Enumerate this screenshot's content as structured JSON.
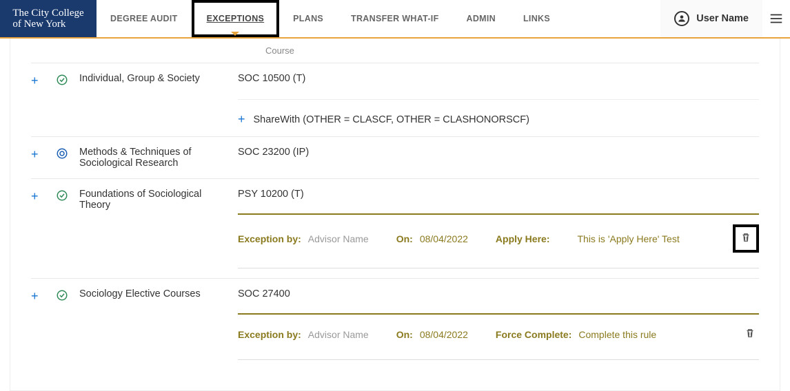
{
  "brand": {
    "line1": "The City College",
    "line2": "of New York"
  },
  "nav": {
    "items": [
      {
        "label": "DEGREE AUDIT",
        "active": false
      },
      {
        "label": "EXCEPTIONS",
        "active": true,
        "highlighted": true
      },
      {
        "label": "PLANS",
        "active": false
      },
      {
        "label": "TRANSFER WHAT-IF",
        "active": false
      },
      {
        "label": "ADMIN",
        "active": false
      },
      {
        "label": "LINKS",
        "active": false
      }
    ]
  },
  "user": {
    "name": "User Name"
  },
  "table": {
    "course_header": "Course"
  },
  "rows": [
    {
      "status": "complete",
      "title": "Individual, Group & Society",
      "course": "SOC 10500 (T)",
      "sharewith": "ShareWith (OTHER = CLASCF, OTHER = CLASHONORSCF)"
    },
    {
      "status": "inprogress",
      "title": "Methods & Techniques of Sociological Research",
      "course": "SOC 23200 (IP)"
    },
    {
      "status": "complete",
      "title": "Foundations of Sociological Theory",
      "course": "PSY 10200 (T)",
      "exception": {
        "by_label": "Exception by:",
        "by_value": "Advisor Name",
        "on_label": "On:",
        "on_value": "08/04/2022",
        "type_label": "Apply Here:",
        "type_value": "This is 'Apply Here' Test",
        "trash_highlighted": true
      }
    },
    {
      "status": "complete",
      "title": "Sociology Elective Courses",
      "course": "SOC 27400",
      "exception": {
        "by_label": "Exception by:",
        "by_value": "Advisor Name",
        "on_label": "On:",
        "on_value": "08/04/2022",
        "type_label": "Force Complete:",
        "type_value": "Complete this rule",
        "trash_highlighted": false
      }
    }
  ]
}
